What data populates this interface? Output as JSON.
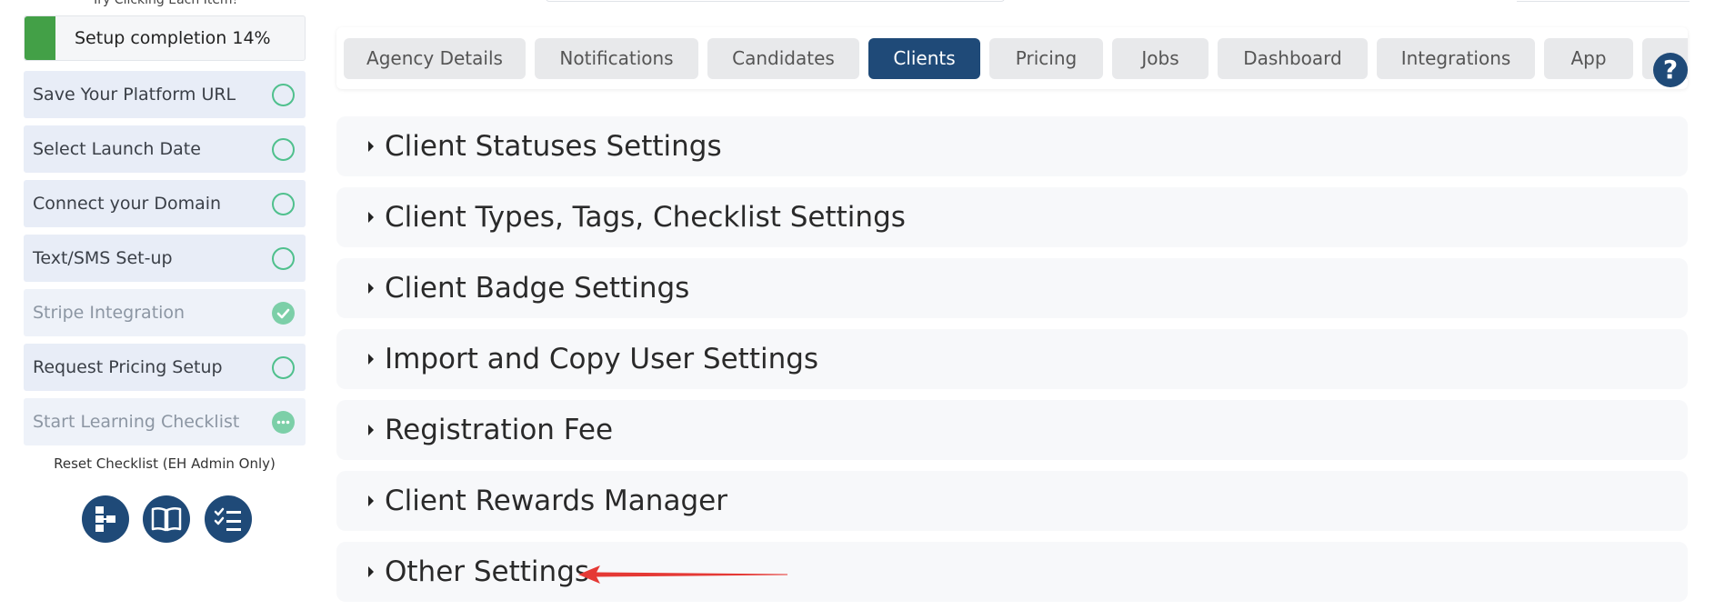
{
  "sidebar": {
    "hint": "Try Clicking Each Item!",
    "progress": {
      "label": "Setup completion 14%",
      "fraction": 0.11
    },
    "items": [
      {
        "label": "Save Your Platform URL",
        "status": "open"
      },
      {
        "label": "Select Launch Date",
        "status": "open"
      },
      {
        "label": "Connect your Domain",
        "status": "open"
      },
      {
        "label": "Text/SMS Set-up",
        "status": "open"
      },
      {
        "label": "Stripe Integration",
        "status": "done"
      },
      {
        "label": "Request Pricing Setup",
        "status": "open"
      },
      {
        "label": "Start Learning Checklist",
        "status": "in-progress"
      }
    ],
    "reset_label": "Reset Checklist (EH Admin Only)",
    "tools": [
      {
        "icon": "sitemap-icon"
      },
      {
        "icon": "book-open-icon"
      },
      {
        "icon": "checklist-icon"
      }
    ]
  },
  "tabs": [
    {
      "label": "Agency Details",
      "active": false
    },
    {
      "label": "Notifications",
      "active": false
    },
    {
      "label": "Candidates",
      "active": false
    },
    {
      "label": "Clients",
      "active": true
    },
    {
      "label": "Pricing",
      "active": false
    },
    {
      "label": "Jobs",
      "active": false
    },
    {
      "label": "Dashboard",
      "active": false
    },
    {
      "label": "Integrations",
      "active": false
    },
    {
      "label": "App",
      "active": false
    }
  ],
  "help_label": "?",
  "sections": [
    {
      "title": "Client Statuses Settings"
    },
    {
      "title": "Client Types, Tags, Checklist Settings"
    },
    {
      "title": "Client Badge Settings"
    },
    {
      "title": "Import and Copy User Settings"
    },
    {
      "title": "Registration Fee"
    },
    {
      "title": "Client Rewards Manager"
    },
    {
      "title": "Other Settings"
    }
  ],
  "colors": {
    "accent": "#1f4a78",
    "progress_fill": "#43a047",
    "status_ring": "#4fc08d",
    "annotation_arrow": "#e53935"
  }
}
